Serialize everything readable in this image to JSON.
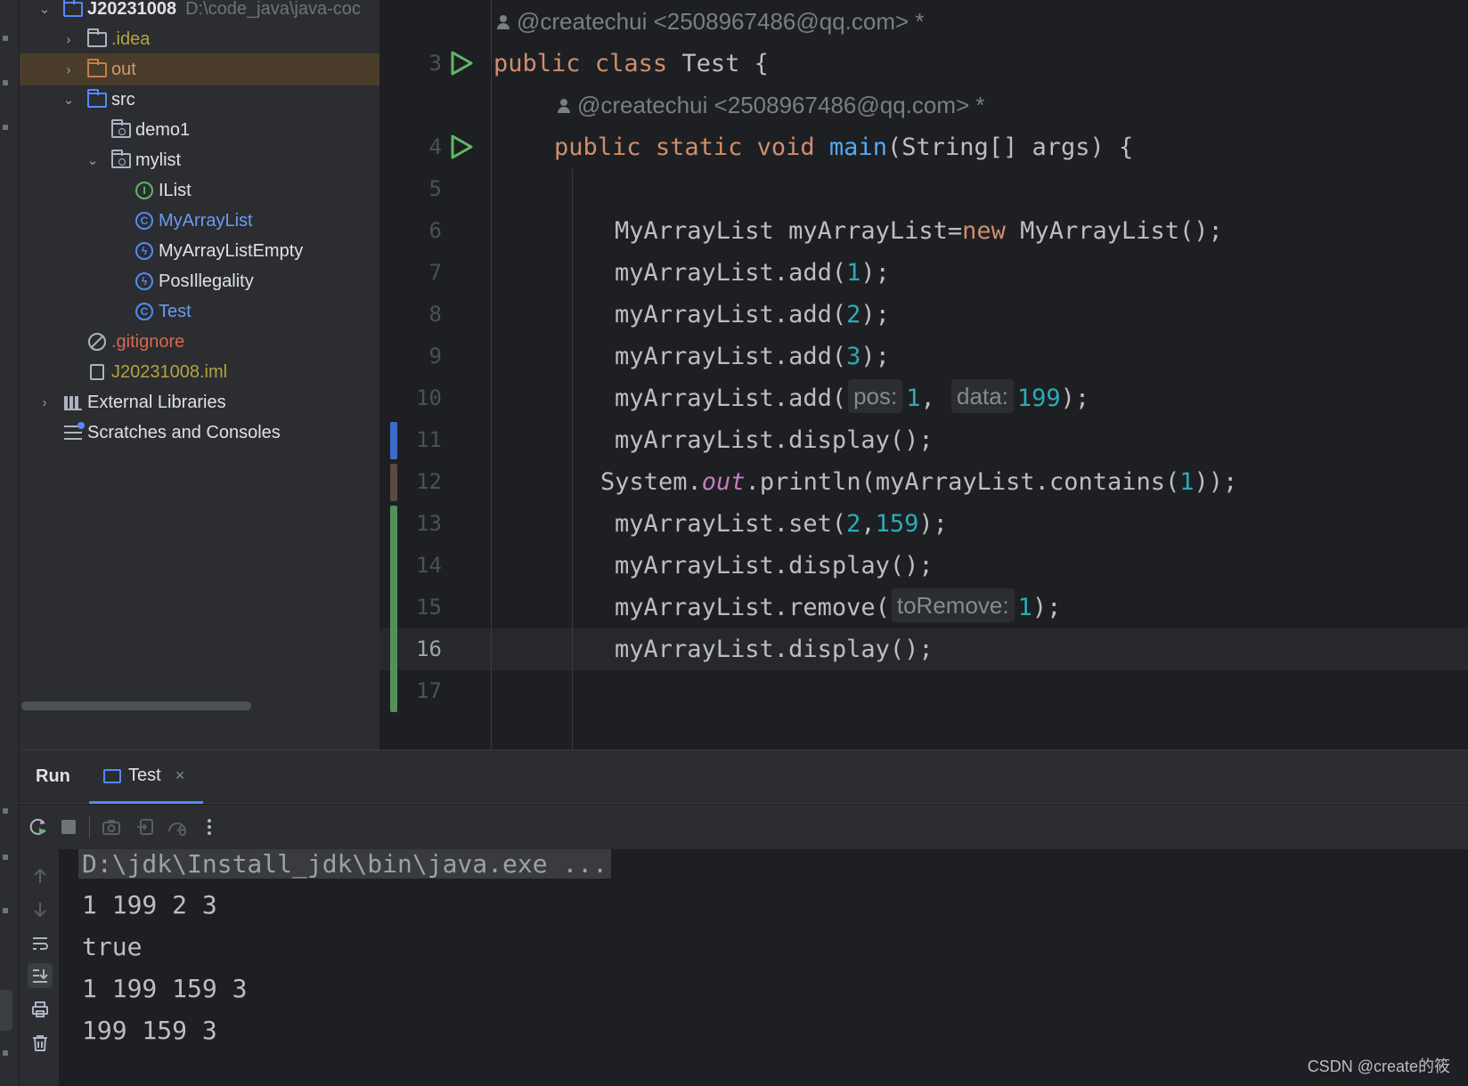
{
  "project_tree": {
    "root": {
      "name": "J20231008",
      "path": "D:\\code_java\\java-coc"
    },
    "items": [
      {
        "label": ".idea",
        "style": "default"
      },
      {
        "label": "out",
        "style": "excluded"
      },
      {
        "label": "src",
        "style": "default"
      },
      {
        "label": "demo1",
        "style": "default"
      },
      {
        "label": "mylist",
        "style": "default"
      },
      {
        "label": "IList",
        "style": "default"
      },
      {
        "label": "MyArrayList",
        "style": "blue"
      },
      {
        "label": "MyArrayListEmpty",
        "style": "default"
      },
      {
        "label": "PosIllegality",
        "style": "default"
      },
      {
        "label": "Test",
        "style": "blue"
      },
      {
        "label": ".gitignore",
        "style": "ignored"
      },
      {
        "label": "J20231008.iml",
        "style": "iml"
      },
      {
        "label": "External Libraries",
        "style": "default"
      },
      {
        "label": "Scratches and Consoles",
        "style": "default"
      }
    ]
  },
  "editor": {
    "author_hint": "@createchui <2508967486@qq.com> *",
    "line_numbers": [
      "3",
      "4",
      "5",
      "6",
      "7",
      "8",
      "9",
      "10",
      "11",
      "12",
      "13",
      "14",
      "15",
      "16",
      "17"
    ],
    "current_line": "16",
    "tokens": {
      "public": "public",
      "class": "class",
      "class_name": "Test {",
      "static": "static",
      "void": "void",
      "main": "main",
      "main_params": "(String[] args) {",
      "decl_prefix": "MyArrayList myArrayList=",
      "new": "new",
      "decl_suffix": " MyArrayList();",
      "add_call": "myArrayList.add(",
      "close": ");",
      "display_call": "myArrayList.display();",
      "system": "System.",
      "out": "out",
      "println_prefix": ".println(myArrayList.contains(",
      "println_close": "));",
      "set_call": "myArrayList.set(",
      "comma": ",",
      "remove_call": "myArrayList.remove(",
      "n1": "1",
      "n2": "2",
      "n3": "3",
      "n199": "199",
      "n159": "159"
    },
    "hints": {
      "pos": "pos:",
      "data": "data:",
      "to_remove": "toRemove:"
    }
  },
  "run_panel": {
    "title": "Run",
    "tab": {
      "label": "Test",
      "close": "×"
    },
    "console": [
      "D:\\jdk\\Install_jdk\\bin\\java.exe ...",
      "1 199 2 3",
      "true",
      "1 199 159 3",
      "199 159 3"
    ]
  },
  "watermark": "CSDN @create的筱",
  "colors": {
    "keyword": "#cf8e6d",
    "function": "#56a8f5",
    "number": "#2aacb8",
    "static_field": "#c77dbb",
    "run_icon": "#5fb865",
    "vcs_modified": "#3b6cc9",
    "vcs_added": "#549159"
  }
}
